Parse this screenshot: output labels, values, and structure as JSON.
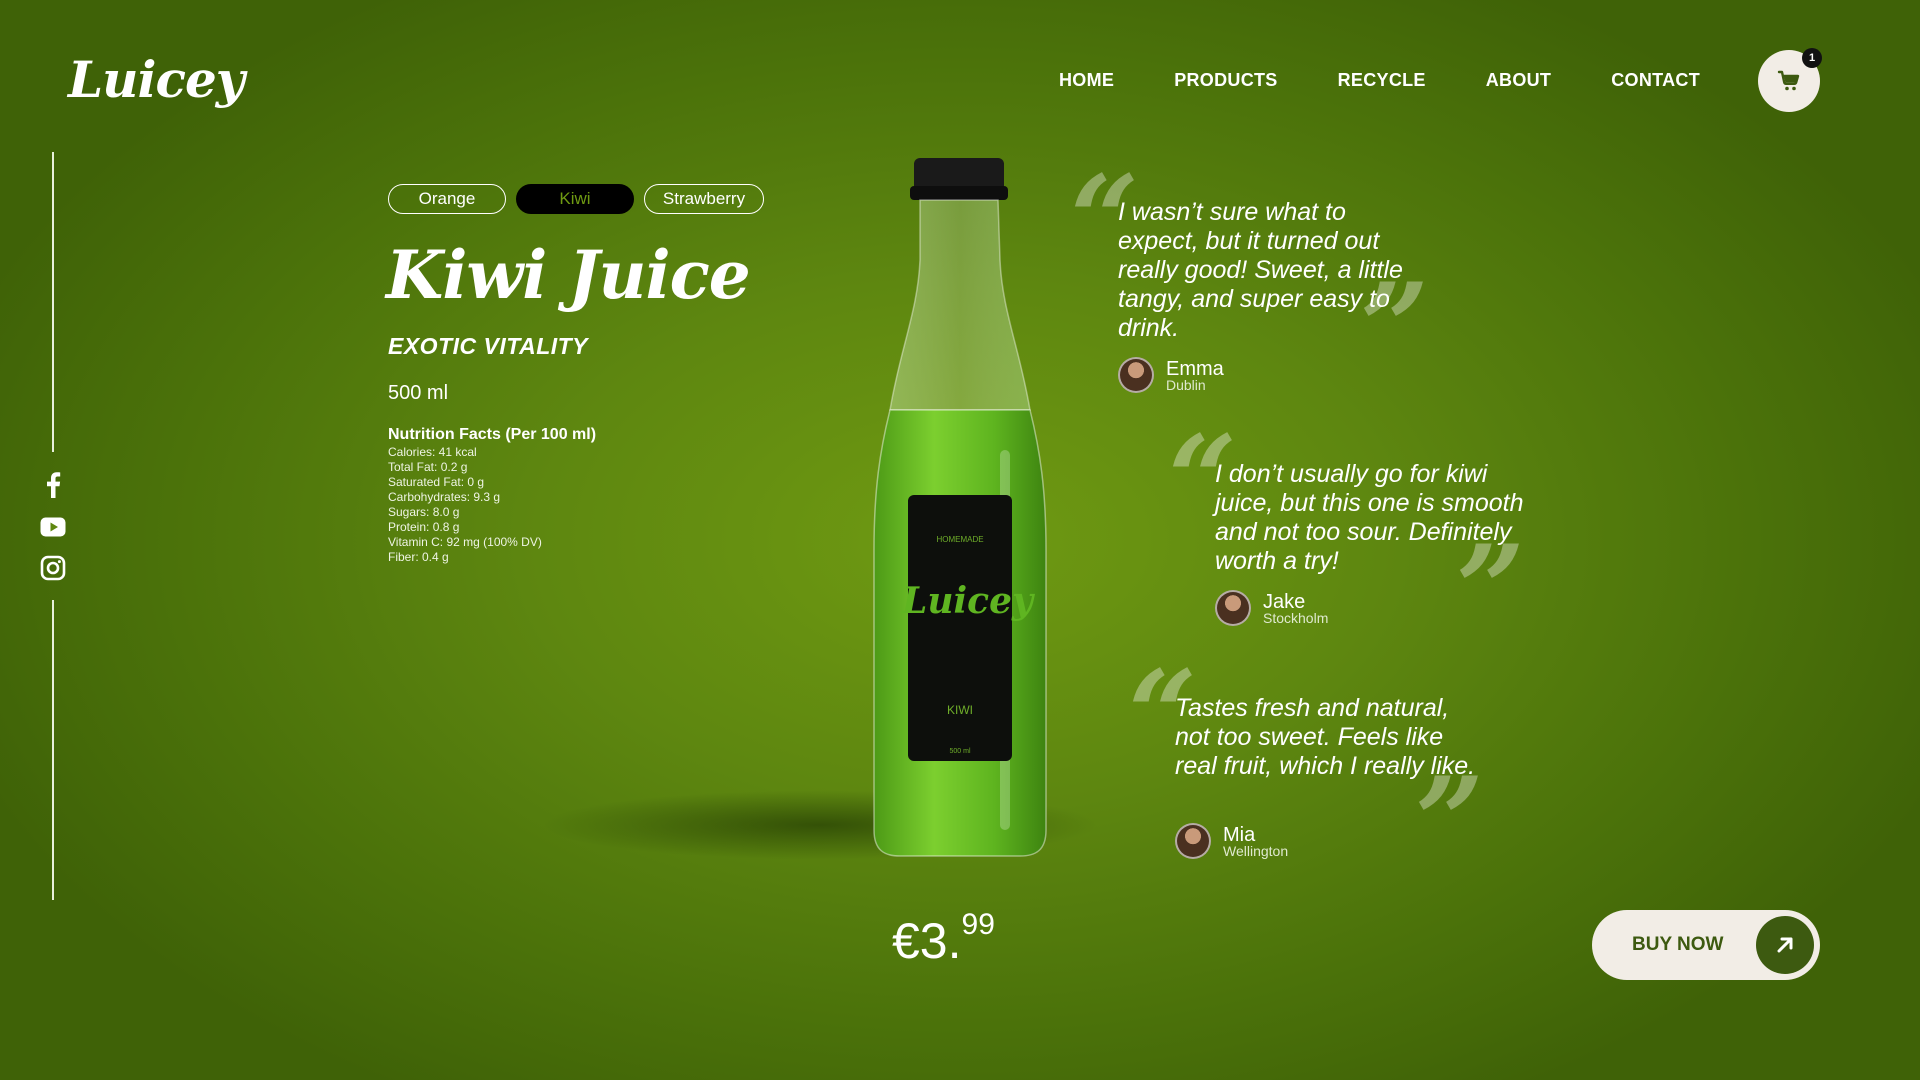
{
  "brand": {
    "logo": "Luicey"
  },
  "nav": {
    "items": [
      "HOME",
      "PRODUCTS",
      "RECYCLE",
      "ABOUT",
      "CONTACT"
    ]
  },
  "cart": {
    "count": "1",
    "icon": "cart-icon"
  },
  "social": [
    "facebook-icon",
    "youtube-icon",
    "instagram-icon"
  ],
  "flavors": {
    "items": [
      "Orange",
      "Kiwi",
      "Strawberry"
    ],
    "selected": "Kiwi"
  },
  "product": {
    "title": "Kiwi Juice",
    "tagline": "EXOTIC VITALITY",
    "volume": "500 ml",
    "nutrition_title": "Nutrition Facts (Per 100 ml)",
    "nutrition": [
      "Calories: 41 kcal",
      "Total Fat: 0.2 g",
      "Saturated Fat: 0 g",
      "Carbohydrates: 9.3 g",
      "Sugars: 8.0 g",
      "Protein: 0.8 g",
      "Vitamin C: 92 mg (100% DV)",
      "Fiber: 0.4 g"
    ],
    "label": {
      "top": "HOMEMADE",
      "brand": "Luicey",
      "flavor": "KIWI",
      "size": "500 ml"
    }
  },
  "reviews": [
    {
      "text": "I wasn’t sure what to expect, but it turned out really good! Sweet, a little tangy, and super easy to drink.",
      "name": "Emma",
      "city": "Dublin"
    },
    {
      "text": "I don’t usually go for kiwi juice, but this one is smooth and not too sour. Definitely worth a try!",
      "name": "Jake",
      "city": "Stockholm"
    },
    {
      "text": "Tastes fresh and natural, not too sweet. Feels like real fruit, which I really like.",
      "name": "Mia",
      "city": "Wellington"
    }
  ],
  "price": {
    "main": "€3.",
    "cents": "99"
  },
  "buy": {
    "label": "BUY NOW",
    "icon": "arrow-up-right-icon"
  },
  "colors": {
    "background": "#5e8710",
    "accent": "#3d5a10",
    "cream": "#f2ede6"
  }
}
